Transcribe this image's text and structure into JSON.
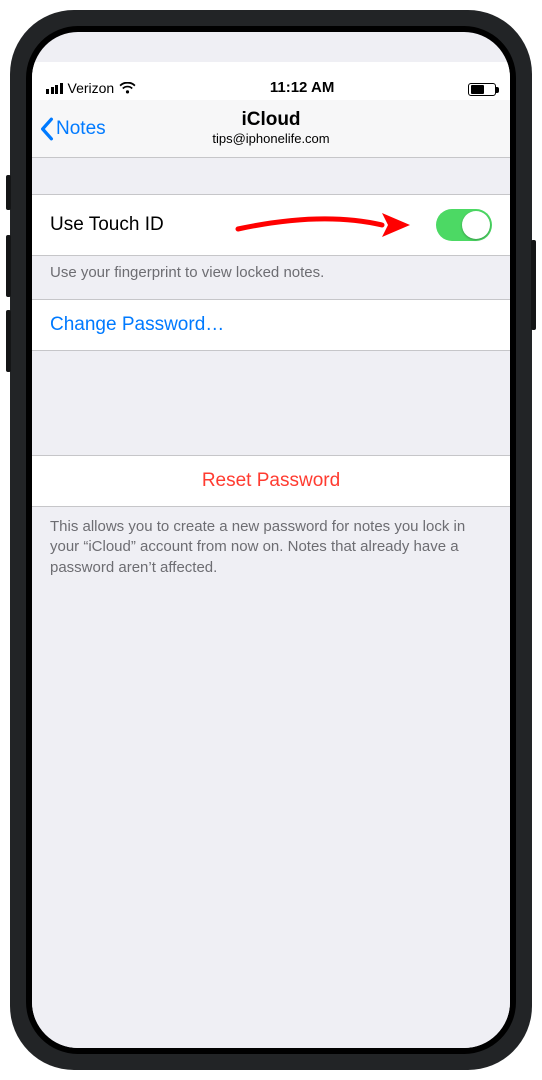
{
  "statusbar": {
    "carrier": "Verizon",
    "time": "11:12 AM",
    "battery_pct": 50
  },
  "nav": {
    "back_label": "Notes",
    "title": "iCloud",
    "subtitle": "tips@iphonelife.com"
  },
  "cells": {
    "touch_id_label": "Use Touch ID",
    "touch_id_footer": "Use your fingerprint to view locked notes.",
    "change_password_label": "Change Password…",
    "reset_password_label": "Reset Password",
    "reset_footer": "This allows you to create a new password for notes you lock in your “iCloud” account from now on. Notes that already have a password aren’t affected."
  },
  "colors": {
    "tint": "#007aff",
    "destructive": "#ff3b30",
    "toggle_on": "#4cd964"
  },
  "toggles": {
    "touch_id_on": true
  }
}
